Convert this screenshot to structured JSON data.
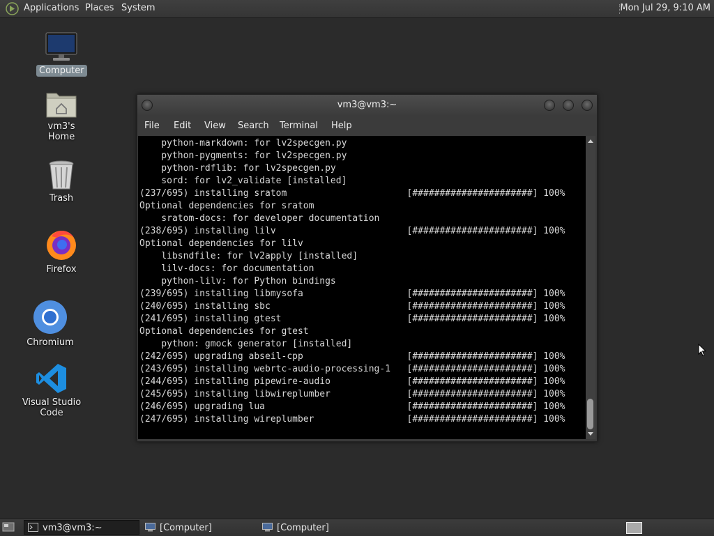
{
  "top_panel": {
    "menus": [
      "Applications",
      "Places",
      "System"
    ],
    "clock": "Mon Jul 29,  9:10 AM"
  },
  "desktop_icons": [
    {
      "name": "computer",
      "label": "Computer",
      "icon": "computer-icon",
      "selected": true
    },
    {
      "name": "home",
      "label": "vm3's Home",
      "icon": "home-folder-icon"
    },
    {
      "name": "trash",
      "label": "Trash",
      "icon": "trash-icon"
    },
    {
      "name": "firefox",
      "label": "Firefox",
      "icon": "firefox-icon"
    },
    {
      "name": "chromium",
      "label": "Chromium",
      "icon": "chromium-icon"
    },
    {
      "name": "vscode",
      "label": "Visual Studio Code",
      "icon": "vscode-icon"
    }
  ],
  "terminal": {
    "title": "vm3@vm3:~",
    "menu": [
      "File",
      "Edit",
      "View",
      "Search",
      "Terminal",
      "Help"
    ],
    "lines": [
      "    python-markdown: for lv2specgen.py",
      "    python-pygments: for lv2specgen.py",
      "    python-rdflib: for lv2specgen.py",
      "    sord: for lv2_validate [installed]",
      "(237/695) installing sratom                      [######################] 100%",
      "Optional dependencies for sratom",
      "    sratom-docs: for developer documentation",
      "(238/695) installing lilv                        [######################] 100%",
      "Optional dependencies for lilv",
      "    libsndfile: for lv2apply [installed]",
      "    lilv-docs: for documentation",
      "    python-lilv: for Python bindings",
      "(239/695) installing libmysofa                   [######################] 100%",
      "(240/695) installing sbc                         [######################] 100%",
      "(241/695) installing gtest                       [######################] 100%",
      "Optional dependencies for gtest",
      "    python: gmock generator [installed]",
      "(242/695) upgrading abseil-cpp                   [######################] 100%",
      "(243/695) installing webrtc-audio-processing-1   [######################] 100%",
      "(244/695) installing pipewire-audio              [######################] 100%",
      "(245/695) installing libwireplumber              [######################] 100%",
      "(246/695) upgrading lua                          [######################] 100%",
      "(247/695) installing wireplumber                 [######################] 100%"
    ]
  },
  "taskbar": {
    "items": [
      {
        "label": "vm3@vm3:~",
        "icon": "terminal-icon",
        "active": true
      },
      {
        "label": "[Computer]",
        "icon": "computer-icon",
        "active": false
      },
      {
        "label": "[Computer]",
        "icon": "computer-icon",
        "active": false
      }
    ]
  },
  "colors": {
    "desktop": "#2b2b2b",
    "panel": "#383838",
    "terminal_bg": "#000000",
    "terminal_fg": "#d8d8d8",
    "selection": "#7d8a92"
  }
}
